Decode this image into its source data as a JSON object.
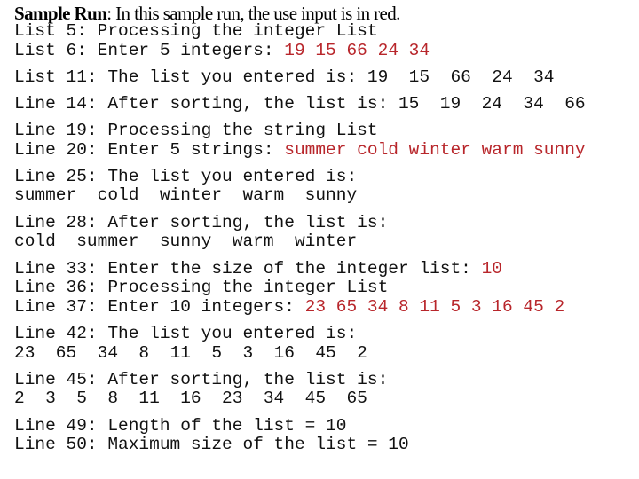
{
  "title": {
    "bold": "Sample Run",
    "rest": ": In this sample run, the use input is in red."
  },
  "colors": {
    "text": "#111111",
    "user_input": "#b8262b",
    "background": "#ffffff"
  },
  "lines": [
    {
      "prefix": "List 5: Processing the integer List",
      "input": ""
    },
    {
      "prefix": "List 6: Enter 5 integers: ",
      "input": "19 15 66 24 34"
    },
    {
      "prefix": "List 11: The list you entered is: 19  15  66  24  34",
      "input": ""
    },
    {
      "prefix": "Line 14: After sorting, the list is: 15  19  24  34  66",
      "input": ""
    },
    {
      "prefix": "Line 19: Processing the string List",
      "input": ""
    },
    {
      "prefix": "Line 20: Enter 5 strings: ",
      "input": "summer cold winter warm sunny"
    },
    {
      "prefix": "Line 25: The list you entered is:",
      "input": ""
    },
    {
      "prefix": "summer  cold  winter  warm  sunny",
      "input": ""
    },
    {
      "prefix": "Line 28: After sorting, the list is:",
      "input": ""
    },
    {
      "prefix": "cold  summer  sunny  warm  winter",
      "input": ""
    },
    {
      "prefix": "Line 33: Enter the size of the integer list: ",
      "input": "10"
    },
    {
      "prefix": "Line 36: Processing the integer List",
      "input": ""
    },
    {
      "prefix": "Line 37: Enter 10 integers: ",
      "input": "23 65 34 8 11 5 3 16 45 2"
    },
    {
      "prefix": "Line 42: The list you entered is:",
      "input": ""
    },
    {
      "prefix": "23  65  34  8  11  5  3  16  45  2",
      "input": ""
    },
    {
      "prefix": "Line 45: After sorting, the list is:",
      "input": ""
    },
    {
      "prefix": "2  3  5  8  11  16  23  34  45  65",
      "input": ""
    },
    {
      "prefix": "Line 49: Length of the list = 10",
      "input": ""
    },
    {
      "prefix": "Line 50: Maximum size of the list = 10",
      "input": ""
    }
  ]
}
